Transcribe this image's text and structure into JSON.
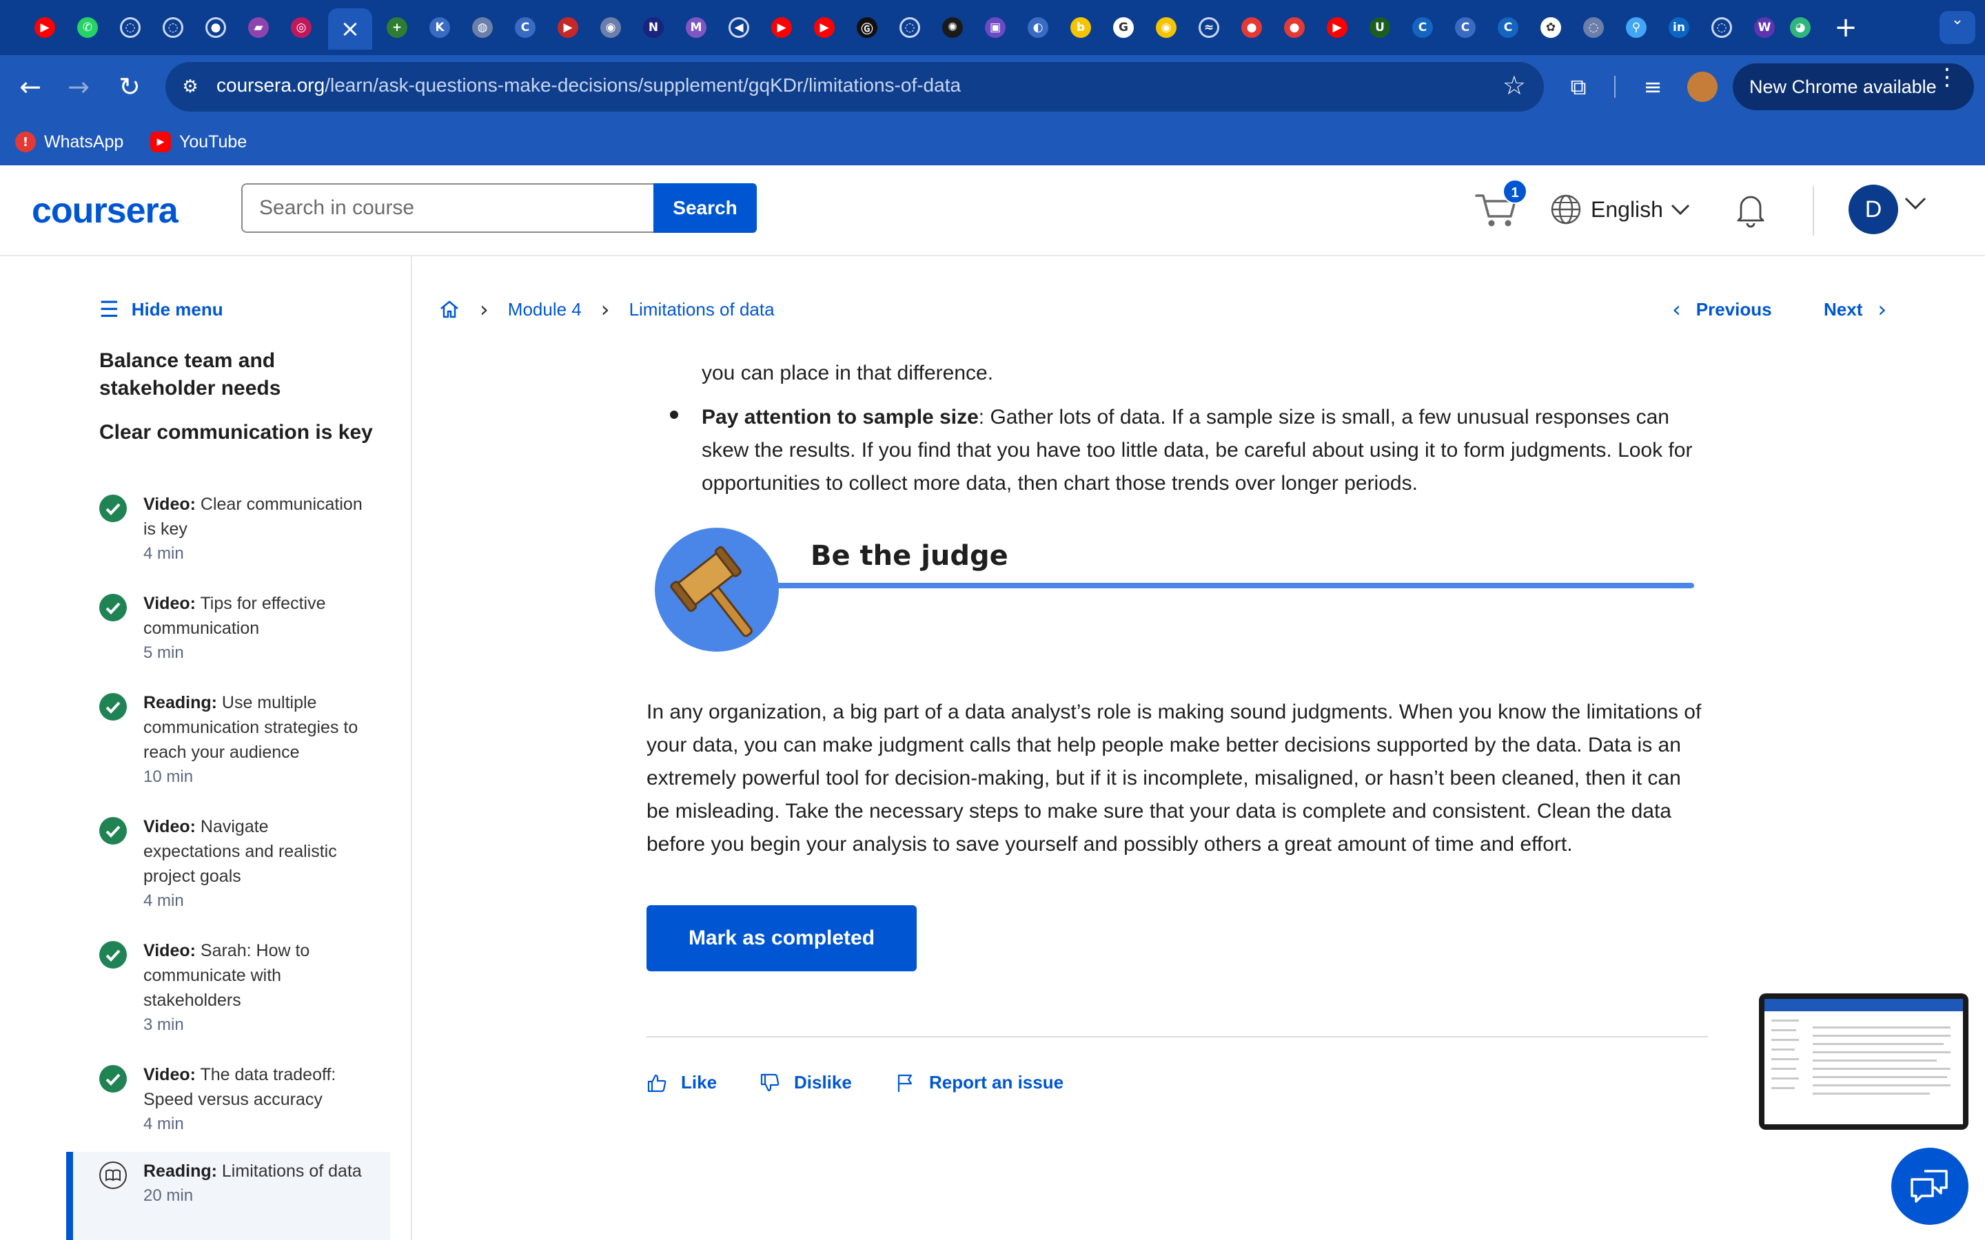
{
  "browser": {
    "tabs": [
      {
        "icon": "youtube-icon",
        "color": "#ff0000",
        "glyph": "▶"
      },
      {
        "icon": "whatsapp-icon",
        "color": "#25d366",
        "glyph": "✆"
      },
      {
        "icon": "loading-icon",
        "color": "#0b3d91",
        "glyph": "◌"
      },
      {
        "icon": "loading-icon",
        "color": "#0b3d91",
        "glyph": "◌"
      },
      {
        "icon": "github-icon",
        "color": "#0b3d91",
        "glyph": "●"
      },
      {
        "icon": "app-icon",
        "color": "#8e44ad",
        "glyph": "▰"
      },
      {
        "icon": "app-icon",
        "color": "#c2185b",
        "glyph": "◎"
      },
      {
        "icon": "close-icon",
        "active": true
      },
      {
        "icon": "app-icon",
        "color": "#2e7d32",
        "glyph": "+"
      },
      {
        "icon": "app-icon",
        "color": "#3a6bc4",
        "glyph": "K"
      },
      {
        "icon": "globe-icon",
        "color": "#6b7fa8",
        "glyph": "◍"
      },
      {
        "icon": "coursera-icon",
        "color": "#3a6bc4",
        "glyph": "C"
      },
      {
        "icon": "youtube-icon",
        "color": "#c62828",
        "glyph": "▶"
      },
      {
        "icon": "app-icon",
        "color": "#6b7fa8",
        "glyph": "◉"
      },
      {
        "icon": "app-icon",
        "color": "#1a237e",
        "glyph": "N"
      },
      {
        "icon": "gmail-icon",
        "color": "#7e57c2",
        "glyph": "M"
      },
      {
        "icon": "speaker-icon",
        "color": "#0b3d91",
        "glyph": "◀"
      },
      {
        "icon": "youtube-icon",
        "color": "#ff0000",
        "glyph": "▶"
      },
      {
        "icon": "youtube-icon",
        "color": "#ff0000",
        "glyph": "▶"
      },
      {
        "icon": "app-icon",
        "color": "#111111",
        "glyph": "Ⓖ"
      },
      {
        "icon": "loading-icon",
        "color": "#0b3d91",
        "glyph": "◌"
      },
      {
        "icon": "app-icon",
        "color": "#1a1a1a",
        "glyph": "✺"
      },
      {
        "icon": "video-icon",
        "color": "#6a4bc4",
        "glyph": "▣"
      },
      {
        "icon": "app-icon",
        "color": "#3a6bc4",
        "glyph": "◐"
      },
      {
        "icon": "app-icon",
        "color": "#f5c400",
        "glyph": "b"
      },
      {
        "icon": "google-icon",
        "color": "#ffffff",
        "glyph": "G"
      },
      {
        "icon": "app-icon",
        "color": "#f5c400",
        "glyph": "◉"
      },
      {
        "icon": "app-icon",
        "color": "#0b3d91",
        "glyph": "≈"
      },
      {
        "icon": "app-icon",
        "color": "#e53935",
        "glyph": "●"
      },
      {
        "icon": "app-icon",
        "color": "#e53935",
        "glyph": "●"
      },
      {
        "icon": "youtube-icon",
        "color": "#ff0000",
        "glyph": "▶"
      },
      {
        "icon": "app-icon",
        "color": "#1b5e20",
        "glyph": "U"
      },
      {
        "icon": "coursera-icon",
        "color": "#1565c0",
        "glyph": "C"
      },
      {
        "icon": "coursera-icon",
        "color": "#3a6bc4",
        "glyph": "C"
      },
      {
        "icon": "coursera-icon",
        "color": "#1565c0",
        "glyph": "C"
      },
      {
        "icon": "openai-icon",
        "color": "#ffffff",
        "glyph": "✿"
      },
      {
        "icon": "app-icon",
        "color": "#6b7fa8",
        "glyph": "◌"
      },
      {
        "icon": "maps-icon",
        "color": "#42a5f5",
        "glyph": "⚲"
      },
      {
        "icon": "linkedin-icon",
        "color": "#0a66c2",
        "glyph": "in"
      },
      {
        "icon": "loading-icon",
        "color": "#0b3d91",
        "glyph": "◌"
      },
      {
        "icon": "app-icon",
        "color": "#5e35b1",
        "glyph": "W"
      },
      {
        "icon": "app-icon",
        "color": "#2eb67d",
        "glyph": "◕"
      }
    ],
    "url_host": "coursera.org",
    "url_path": "/learn/ask-questions-make-decisions/supplement/gqKDr/limitations-of-data",
    "new_chrome_label": "New Chrome available",
    "bookmarks": [
      {
        "label": "WhatsApp",
        "icon": "alert-icon",
        "color": "#e53935",
        "glyph": "!"
      },
      {
        "label": "YouTube",
        "icon": "youtube-icon",
        "color": "#ff0000",
        "glyph": "▶"
      }
    ]
  },
  "header": {
    "logo": "coursera",
    "search_placeholder": "Search in course",
    "search_button": "Search",
    "cart_count": "1",
    "language": "English",
    "user_initial": "D"
  },
  "sidebar": {
    "hide_menu": "Hide menu",
    "section_1": "Balance team and stakeholder needs",
    "section_2": "Clear communication is key",
    "items": [
      {
        "type": "Video:",
        "title": "Clear communication is key",
        "duration": "4 min"
      },
      {
        "type": "Video:",
        "title": "Tips for effective communication",
        "duration": "5 min"
      },
      {
        "type": "Reading:",
        "title": "Use multiple communication strategies to reach your audience",
        "duration": "10 min"
      },
      {
        "type": "Video:",
        "title": "Navigate expectations and realistic project goals",
        "duration": "4 min"
      },
      {
        "type": "Video:",
        "title": "Sarah: How to communicate with stakeholders",
        "duration": "3 min"
      },
      {
        "type": "Video:",
        "title": "The data tradeoff: Speed versus accuracy",
        "duration": "4 min"
      },
      {
        "type": "Reading:",
        "title": "Limitations of data",
        "duration": "20 min"
      }
    ]
  },
  "main": {
    "breadcrumb": {
      "module": "Module 4",
      "page": "Limitations of data"
    },
    "previous": "Previous",
    "next": "Next",
    "continued_text": "you can place in that difference.",
    "bullet_bold": "Pay attention to sample size",
    "bullet_text": ": Gather lots of data. If a sample size is small, a few unusual responses can skew the results. If you find that you have too little data, be careful about using it to form judgments. Look for opportunities to collect more data, then chart those trends over longer periods.",
    "banner_title": "Be the judge",
    "body_text": "In any organization, a big part of a data analyst’s role is making sound judgments. When you know the limitations of your data, you can make judgment calls that help people make better decisions supported by the data. Data is an extremely powerful tool for decision-making, but if it is incomplete, misaligned, or hasn’t been cleaned, then it can be misleading. Take the necessary steps to make sure that your data is complete and consistent. Clean the data before you begin your analysis to save yourself and possibly others a great amount of time and effort.",
    "mark_completed": "Mark as completed",
    "like": "Like",
    "dislike": "Dislike",
    "report": "Report an issue"
  },
  "colors": {
    "brand": "#0056d2",
    "check": "#1f8354",
    "banner": "#4a86e8"
  }
}
